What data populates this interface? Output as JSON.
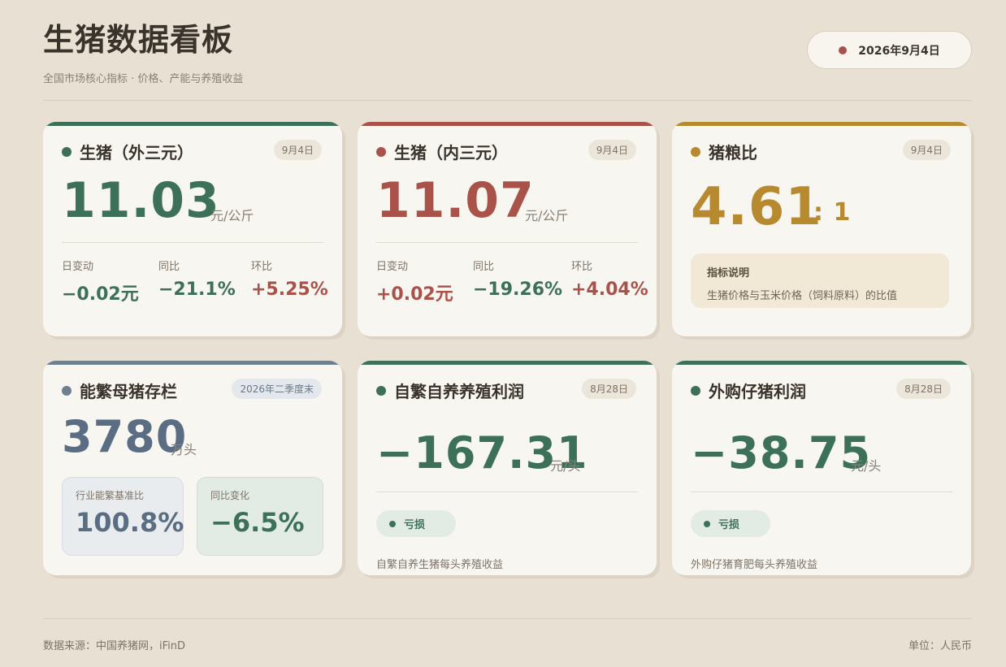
{
  "header": {
    "title": "生猪数据看板",
    "subtitle": "全国市场核心指标 · 价格、产能与养殖收益",
    "date": "2026年9月4日"
  },
  "colors": {
    "background": "#e8e0d2",
    "green": "#3d7058",
    "red": "#a9524a",
    "gold": "#b78a30",
    "slate": "#5b6d82"
  },
  "cards": {
    "outer": {
      "title": "生猪（外三元）",
      "tag": "9月4日",
      "value": "11.03",
      "unit": "元/公斤",
      "stats": [
        {
          "label": "日变动",
          "value": "−0.02元"
        },
        {
          "label": "同比",
          "value": "−21.1%"
        },
        {
          "label": "环比",
          "value": "+5.25%"
        }
      ]
    },
    "inner": {
      "title": "生猪（内三元）",
      "tag": "9月4日",
      "value": "11.07",
      "unit": "元/公斤",
      "stats": [
        {
          "label": "日变动",
          "value": "+0.02元"
        },
        {
          "label": "同比",
          "value": "−19.26%"
        },
        {
          "label": "环比",
          "value": "+4.04%"
        }
      ]
    },
    "ratio": {
      "title": "猪粮比",
      "tag": "9月4日",
      "value": "4.61",
      "suffix": ": 1",
      "note_title": "指标说明",
      "note_text": "生猪价格与玉米价格（饲料原料）的比值"
    },
    "sows": {
      "title": "能繁母猪存栏",
      "tag": "2026年二季度末",
      "value": "3780",
      "unit": "万头",
      "box1_label": "行业能繁基准比",
      "box1_value": "100.8%",
      "box2_label": "同比变化",
      "box2_value": "−6.5%"
    },
    "self_profit": {
      "title": "自繁自养养殖利润",
      "tag": "8月28日",
      "value": "−167.31",
      "unit": "元/头",
      "status": "亏损",
      "desc": "自繁自养生猪每头养殖收益"
    },
    "bought_profit": {
      "title": "外购仔猪利润",
      "tag": "8月28日",
      "value": "−38.75",
      "unit": "元/头",
      "status": "亏损",
      "desc": "外购仔猪育肥每头养殖收益"
    }
  },
  "footer": {
    "source": "数据来源：中国养猪网，iFinD",
    "unit": "单位：人民币"
  }
}
